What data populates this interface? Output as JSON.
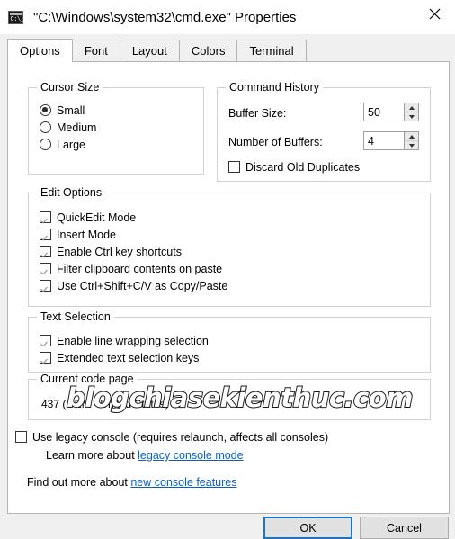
{
  "window": {
    "title": "\"C:\\Windows\\system32\\cmd.exe\" Properties",
    "icon_name": "cmd-console-icon",
    "icon_prompt": "C:\\_",
    "close_label": "✕"
  },
  "tabs": [
    {
      "label": "Options",
      "active": true
    },
    {
      "label": "Font",
      "active": false
    },
    {
      "label": "Layout",
      "active": false
    },
    {
      "label": "Colors",
      "active": false
    },
    {
      "label": "Terminal",
      "active": false
    }
  ],
  "cursor_size": {
    "legend": "Cursor Size",
    "options": [
      {
        "label": "Small",
        "selected": true
      },
      {
        "label": "Medium",
        "selected": false
      },
      {
        "label": "Large",
        "selected": false
      }
    ]
  },
  "command_history": {
    "legend": "Command History",
    "buffer_size": {
      "label": "Buffer Size:",
      "value": "50"
    },
    "number_of_buffers": {
      "label": "Number of Buffers:",
      "value": "4"
    },
    "discard_old_duplicates": {
      "label": "Discard Old Duplicates",
      "checked": false
    }
  },
  "edit_options": {
    "legend": "Edit Options",
    "items": [
      {
        "label": "QuickEdit Mode",
        "checked": true
      },
      {
        "label": "Insert Mode",
        "checked": true
      },
      {
        "label": "Enable Ctrl key shortcuts",
        "checked": true
      },
      {
        "label": "Filter clipboard contents on paste",
        "checked": true
      },
      {
        "label": "Use Ctrl+Shift+C/V as Copy/Paste",
        "checked": true
      }
    ]
  },
  "text_selection": {
    "legend": "Text Selection",
    "items": [
      {
        "label": "Enable line wrapping selection",
        "checked": true
      },
      {
        "label": "Extended text selection keys",
        "checked": true
      }
    ]
  },
  "current_code_page": {
    "legend": "Current code page",
    "value": "437  (OEM - United States)"
  },
  "legacy": {
    "checkbox_label": "Use legacy console (requires relaunch, affects all consoles)",
    "checked": false,
    "learn_more_prefix": "Learn more about ",
    "learn_more_link": "legacy console mode",
    "find_out_prefix": "Find out more about ",
    "find_out_link": "new console features"
  },
  "buttons": {
    "ok": "OK",
    "cancel": "Cancel"
  },
  "watermark": {
    "text": "blogchiasekienthuc.com"
  },
  "colors": {
    "accent": "#1a76c4",
    "link": "#0b60c4",
    "dialog_bg": "#f0f0f0",
    "page_bg": "#ffffff",
    "group_border": "#d0d0d0"
  }
}
